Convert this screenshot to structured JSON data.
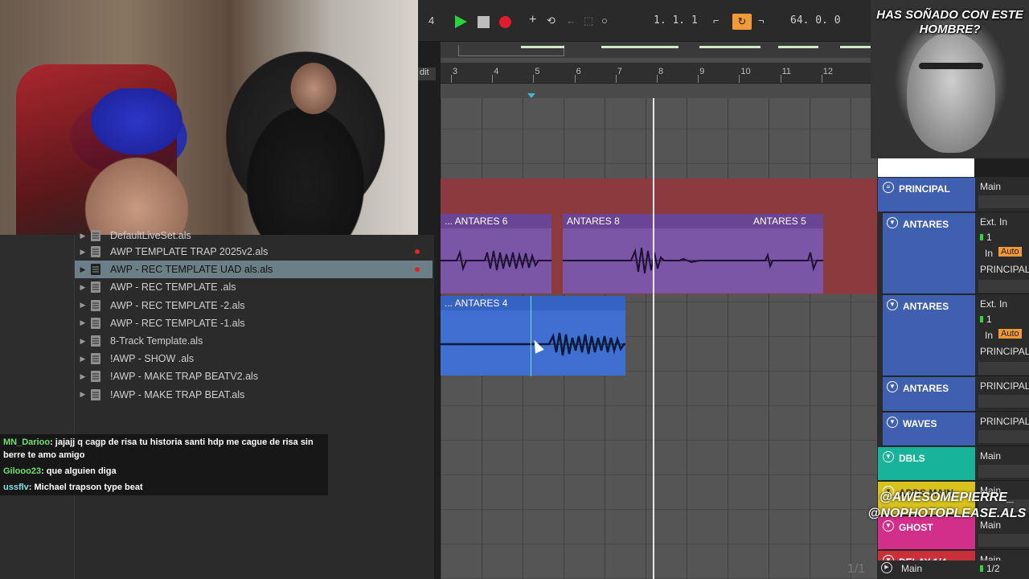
{
  "overlay": {
    "caption": "HAS SOÑADO CON ESTE HOMBRE?",
    "watermark_line1": "@AWESOMEPIERRE_",
    "watermark_line2": "@NOPHOTOPLEASE.ALS"
  },
  "transport": {
    "left_value": "4",
    "position": "1.  1.  1",
    "loop_length": "64.  0.  0",
    "accent_color": "#f39a37",
    "play_color": "#28d43b",
    "record_color": "#e11d2b"
  },
  "browser": {
    "partial_top": "DefaultLiveSet.als",
    "files": [
      {
        "name": "AWP TEMPLATE TRAP 2025v2.als",
        "selected": false,
        "dot": true
      },
      {
        "name": "AWP - REC TEMPLATE UAD als.als",
        "selected": true,
        "dot": true
      },
      {
        "name": "AWP - REC TEMPLATE .als",
        "selected": false,
        "dot": false
      },
      {
        "name": "AWP - REC TEMPLATE -2.als",
        "selected": false,
        "dot": false
      },
      {
        "name": "AWP - REC TEMPLATE -1.als",
        "selected": false,
        "dot": false
      },
      {
        "name": "8-Track Template.als",
        "selected": false,
        "dot": false
      },
      {
        "name": "!AWP - SHOW .als",
        "selected": false,
        "dot": false
      },
      {
        "name": "!AWP - MAKE TRAP BEATV2.als",
        "selected": false,
        "dot": false
      },
      {
        "name": "!AWP - MAKE TRAP BEAT.als",
        "selected": false,
        "dot": false
      }
    ]
  },
  "chat": [
    {
      "user": "MN_Darioo",
      "message": ": jajajj q cagp de risa tu historia santi hdp me cague de risa sin berre te amo amigo"
    },
    {
      "user": "Gilooo23",
      "message": ": que alguien diga"
    },
    {
      "user": "ussflv",
      "message": ": Michael trapson type beat"
    }
  ],
  "ruler": {
    "edit_label": "dit",
    "numbers": [
      "3",
      "4",
      "5",
      "6",
      "7",
      "8",
      "9",
      "10",
      "11",
      "12"
    ]
  },
  "clips": {
    "row1": [
      {
        "label": "... ANTARES 6"
      },
      {
        "label": "ANTARES 8"
      },
      {
        "label": "ANTARES 5"
      }
    ],
    "row2": [
      {
        "label": "... ANTARES 4"
      }
    ]
  },
  "tracks": [
    {
      "name": "PRINCIPAL",
      "io": "Main",
      "color": "#3f5fb0"
    },
    {
      "name": "ANTARES",
      "io": "Ext. In",
      "channel": "1",
      "monitor_in": "In",
      "monitor_auto": "Auto",
      "output": "PRINCIPAL",
      "color": "#3f5fb0"
    },
    {
      "name": "ANTARES",
      "io": "Ext. In",
      "channel": "1",
      "monitor_in": "In",
      "monitor_auto": "Auto",
      "output": "PRINCIPAL",
      "color": "#3f5fb0"
    },
    {
      "name": "ANTARES",
      "io": "PRINCIPAL",
      "color": "#3f5fb0"
    },
    {
      "name": "WAVES",
      "io": "PRINCIPAL",
      "color": "#3f5fb0"
    },
    {
      "name": "DBLS",
      "io": "Main",
      "color": "#17b39a"
    },
    {
      "name": "ADDS MAIN",
      "io": "Main",
      "color": "#d8c21d"
    },
    {
      "name": "GHOST",
      "io": "Main",
      "color": "#d22f8a"
    },
    {
      "name": "DELAY 1/4",
      "io": "Main",
      "color": "#c9303a"
    }
  ],
  "footer": {
    "scroll_count": "1/1",
    "master_label": "Main",
    "master_value": "1/2"
  }
}
